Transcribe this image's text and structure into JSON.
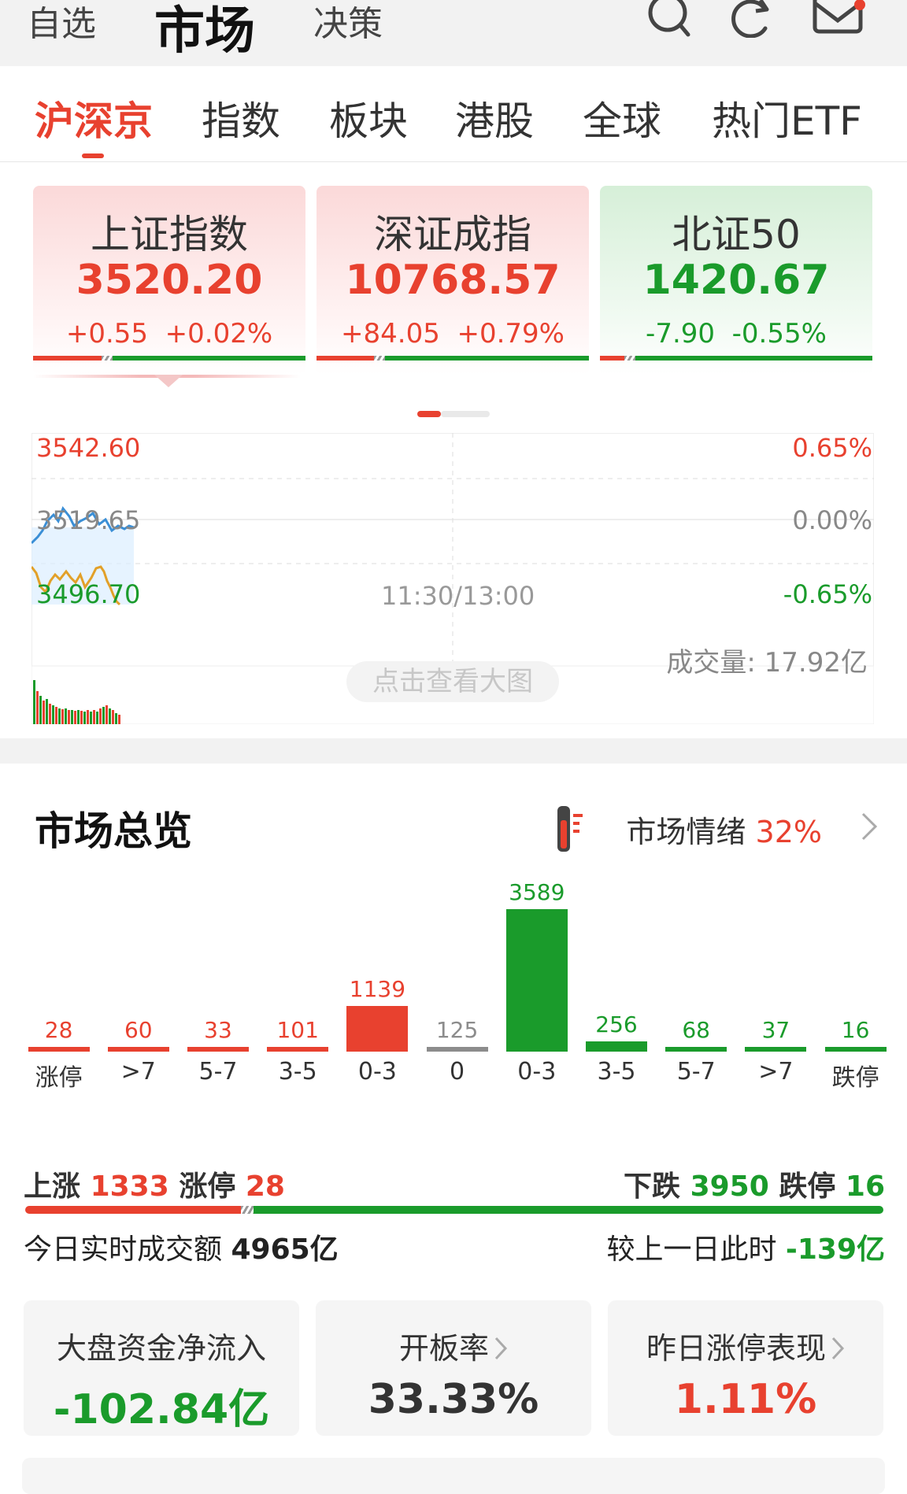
{
  "header": {
    "tabs": [
      "自选",
      "市场",
      "决策"
    ],
    "active_tab": "市场",
    "icons": [
      "search-icon",
      "refresh-icon",
      "mail-icon"
    ],
    "mail_badge_color": "#e8412f"
  },
  "sub_tabs": {
    "items": [
      "沪深京",
      "指数",
      "板块",
      "港股",
      "全球",
      "热门ETF"
    ],
    "active": "沪深京"
  },
  "index_cards": [
    {
      "name": "上证指数",
      "value": "3520.20",
      "change": "+0.55",
      "pct": "+0.02%",
      "trend": "up",
      "up_ratio": 0.25
    },
    {
      "name": "深证成指",
      "value": "10768.57",
      "change": "+84.05",
      "pct": "+0.79%",
      "trend": "up",
      "up_ratio": 0.21
    },
    {
      "name": "北证50",
      "value": "1420.67",
      "change": "-7.90",
      "pct": "-0.55%",
      "trend": "down",
      "up_ratio": 0.09
    }
  ],
  "intraday": {
    "price_high": "3542.60",
    "price_mid": "3519.65",
    "price_low": "3496.70",
    "pct_high": "0.65%",
    "pct_mid": "0.00%",
    "pct_low": "-0.65%",
    "time_label": "11:30/13:00",
    "view_big_label": "点击查看大图",
    "volume_label": "成交量: 17.92亿"
  },
  "overview": {
    "title": "市场总览",
    "mood_label": "市场情绪",
    "mood_value": "32%",
    "distribution": [
      {
        "cat": "涨停",
        "value": 28,
        "side": "up"
      },
      {
        "cat": ">7",
        "value": 60,
        "side": "up"
      },
      {
        "cat": "5-7",
        "value": 33,
        "side": "up"
      },
      {
        "cat": "3-5",
        "value": 101,
        "side": "up"
      },
      {
        "cat": "0-3",
        "value": 1139,
        "side": "up"
      },
      {
        "cat": "0",
        "value": 125,
        "side": "flat"
      },
      {
        "cat": "0-3",
        "value": 3589,
        "side": "down"
      },
      {
        "cat": "3-5",
        "value": 256,
        "side": "down"
      },
      {
        "cat": "5-7",
        "value": 68,
        "side": "down"
      },
      {
        "cat": ">7",
        "value": 37,
        "side": "down"
      },
      {
        "cat": "跌停",
        "value": 16,
        "side": "down"
      }
    ],
    "rise_label": "上涨",
    "rise_count": "1333",
    "limit_up_label": "涨停",
    "limit_up_count": "28",
    "fall_label": "下跌",
    "fall_count": "3950",
    "limit_down_label": "跌停",
    "limit_down_count": "16",
    "turnover_label": "今日实时成交额",
    "turnover_value": "4965亿",
    "compare_label": "较上一日此时",
    "compare_value": "-139亿",
    "stats": [
      {
        "label": "大盘资金净流入",
        "value": "-102.84亿",
        "color": "#1a9b2b",
        "has_arrow": false
      },
      {
        "label": "开板率",
        "value": "33.33%",
        "color": "#333333",
        "has_arrow": true
      },
      {
        "label": "昨日涨停表现",
        "value": "1.11%",
        "color": "#e8412f",
        "has_arrow": true
      }
    ]
  },
  "colors": {
    "up": "#e8412f",
    "down": "#1a9b2b",
    "flat": "#8c8c8c"
  }
}
